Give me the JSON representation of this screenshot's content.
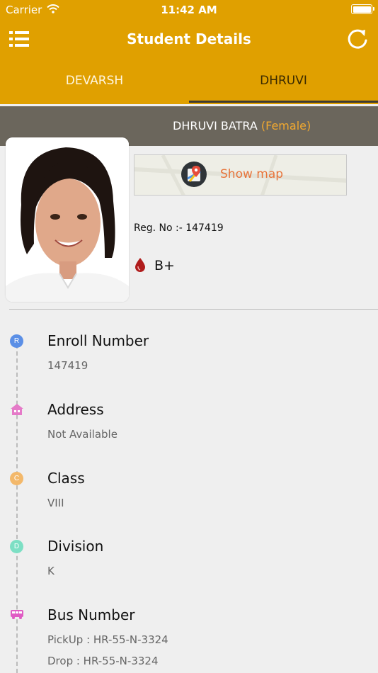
{
  "status_bar": {
    "carrier": "Carrier",
    "time": "11:42 AM"
  },
  "navbar": {
    "title": "Student Details",
    "menu_icon": "list-menu-icon",
    "refresh_icon": "refresh-icon"
  },
  "tabs": [
    {
      "label": "DEVARSH",
      "selected": false
    },
    {
      "label": "DHRUVI",
      "selected": true
    }
  ],
  "student": {
    "name": "DHRUVI BATRA",
    "gender": "(Female)",
    "reg_no": "Reg. No :- 147419",
    "blood_group": "B+",
    "map_button": "Show map"
  },
  "details": [
    {
      "label": "Enroll Number",
      "value": "147419",
      "marker": "R",
      "marker_color": "#5b8fe6"
    },
    {
      "label": "Address",
      "value": "Not Available",
      "marker_icon": "house-icon",
      "marker_color": "#e57ac8"
    },
    {
      "label": "Class",
      "value": "VIII",
      "marker": "C",
      "marker_color": "#f3b86a"
    },
    {
      "label": "Division",
      "value": "K",
      "marker": "D",
      "marker_color": "#7ddfc4"
    },
    {
      "label": "Bus Number",
      "pickup": "PickUp : HR-55-N-3324",
      "drop": "Drop : HR-55-N-3324",
      "marker_icon": "bus-icon",
      "marker_color": "#e05cc4"
    }
  ],
  "colors": {
    "header": "#e0a000",
    "name_bar": "#6b665c",
    "gender": "#f0a830",
    "map_label": "#e8743a"
  }
}
